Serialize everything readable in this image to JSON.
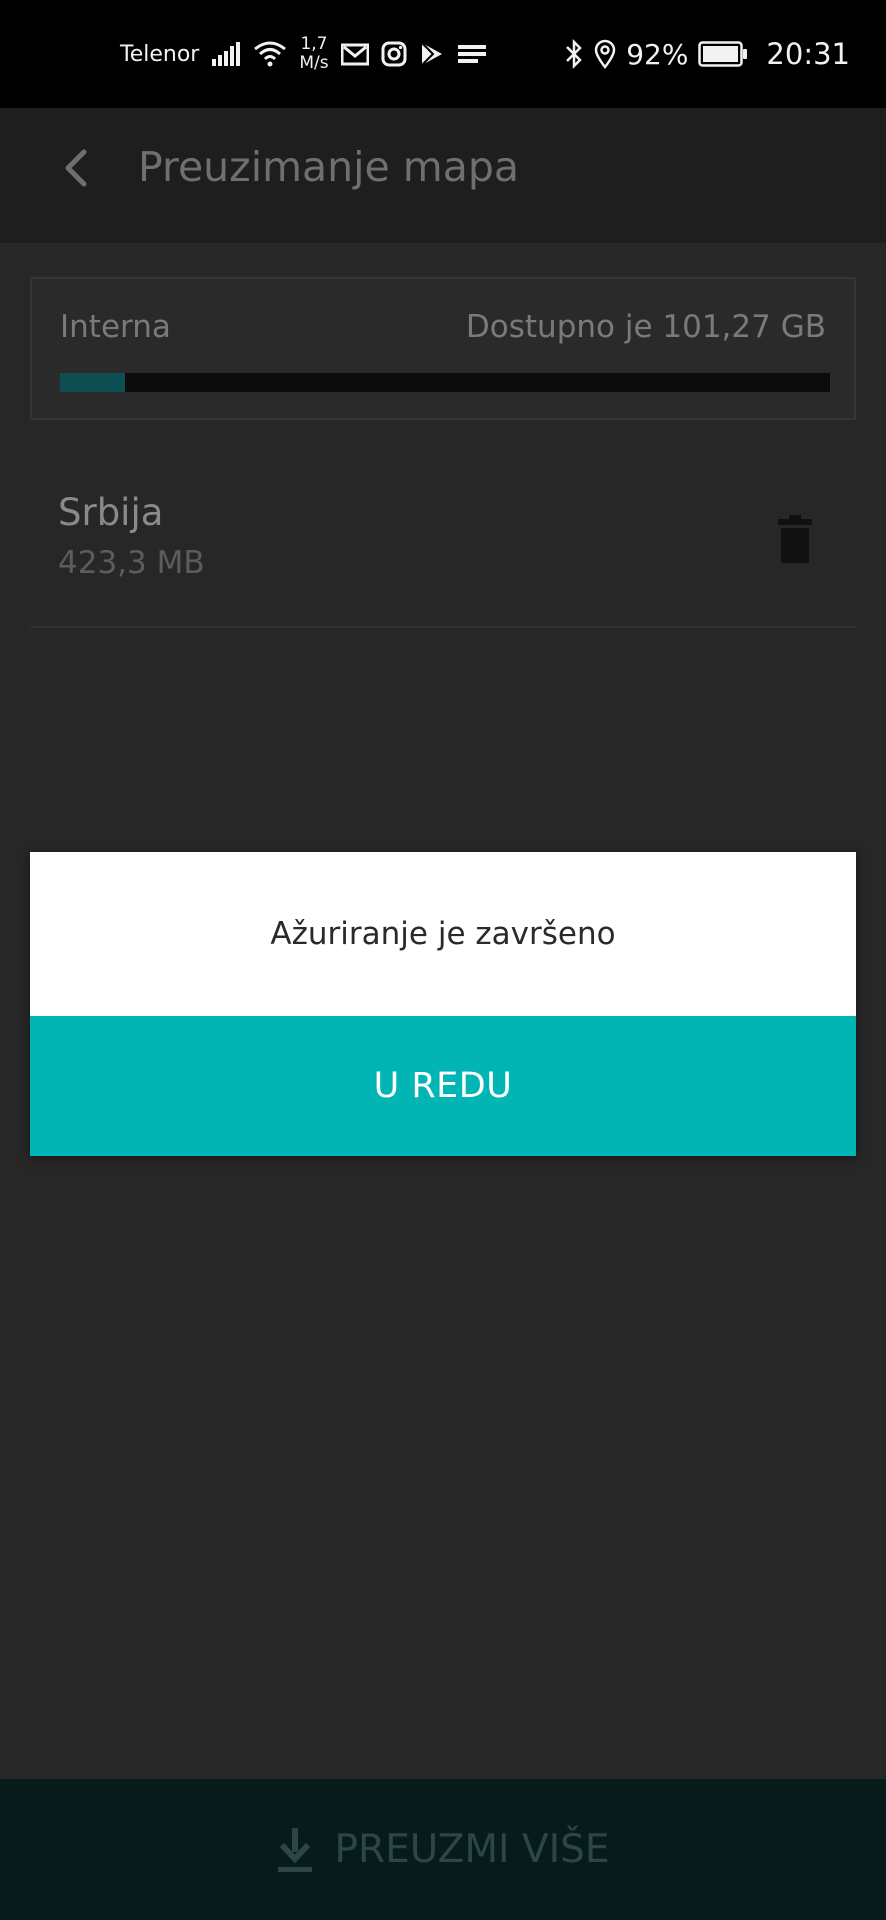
{
  "status_bar": {
    "carrier": "Telenor",
    "net_speed_value": "1,7",
    "net_speed_unit": "M/s",
    "battery_percent": "92%",
    "time": "20:31",
    "icons": [
      "signal-icon",
      "wifi-icon",
      "gmail-icon",
      "instagram-icon",
      "play-store-icon",
      "notification-lines-icon",
      "bluetooth-icon",
      "location-icon",
      "battery-icon"
    ]
  },
  "app_bar": {
    "title": "Preuzimanje mapa",
    "back_icon": "chevron-left-icon"
  },
  "storage": {
    "name": "Interna",
    "available": "Dostupno je 101,27 GB",
    "used_fraction": 0.085
  },
  "maps": [
    {
      "name": "Srbija",
      "size": "423,3 MB",
      "action_icon": "trash-icon"
    }
  ],
  "dialog": {
    "message": "Ažuriranje je završeno",
    "ok_label": "U REDU"
  },
  "bottom_bar": {
    "label": "PREUZMI VIŠE",
    "icon": "download-icon"
  },
  "colors": {
    "accent": "#02b5b5",
    "dialog_bg": "#ffffff",
    "bottom_bar_bg": "#081b1b",
    "storage_fill": "#0e4e53"
  }
}
